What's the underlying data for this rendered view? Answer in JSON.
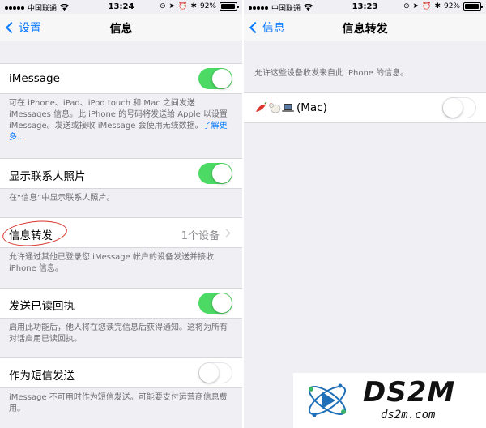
{
  "left": {
    "status": {
      "carrier": "中国联通",
      "time": "13:24",
      "battery": "92%"
    },
    "nav": {
      "back_label": "设置",
      "title": "信息"
    },
    "imessage": {
      "label": "iMessage",
      "enabled": true
    },
    "imessage_footer": {
      "text": "可在 iPhone、iPad、iPod touch 和 Mac 之间发送 iMessages 信息。此 iPhone 的号码将发送给 Apple 以设置 iMessage。发送或接收 iMessage 会使用无线数据。",
      "link": "了解更多..."
    },
    "contact_photos": {
      "label": "显示联系人照片",
      "enabled": true
    },
    "contact_photos_footer": "在“信息”中显示联系人照片。",
    "forwarding": {
      "label": "信息转发",
      "value": "1个设备"
    },
    "forwarding_footer": "允许通过其他已登录您 iMessage 帐户的设备发送并接收 iPhone 信息。",
    "read_receipts": {
      "label": "发送已读回执",
      "enabled": true
    },
    "read_receipts_footer": "启用此功能后，他人将在您读完信息后获得通知。这将为所有对话启用已读回执。",
    "send_as_sms": {
      "label": "作为短信发送",
      "enabled": false
    },
    "send_as_sms_footer": "iMessage 不可用时作为短信发送。可能要支付运营商信息费用。"
  },
  "right": {
    "status": {
      "carrier": "中国联通",
      "time": "13:23",
      "battery": "92%"
    },
    "nav": {
      "back_label": "信息",
      "title": "信息转发"
    },
    "header": "允许这些设备收发来自此 iPhone 的信息。",
    "device": {
      "label": "(Mac)",
      "enabled": false
    }
  },
  "watermark": {
    "title": "DS2M",
    "subtitle": "ds2m.com"
  },
  "colors": {
    "accent": "#0a7aff",
    "toggle_on": "#4cd964",
    "background": "#efeff4"
  },
  "battery_level": 0.92
}
